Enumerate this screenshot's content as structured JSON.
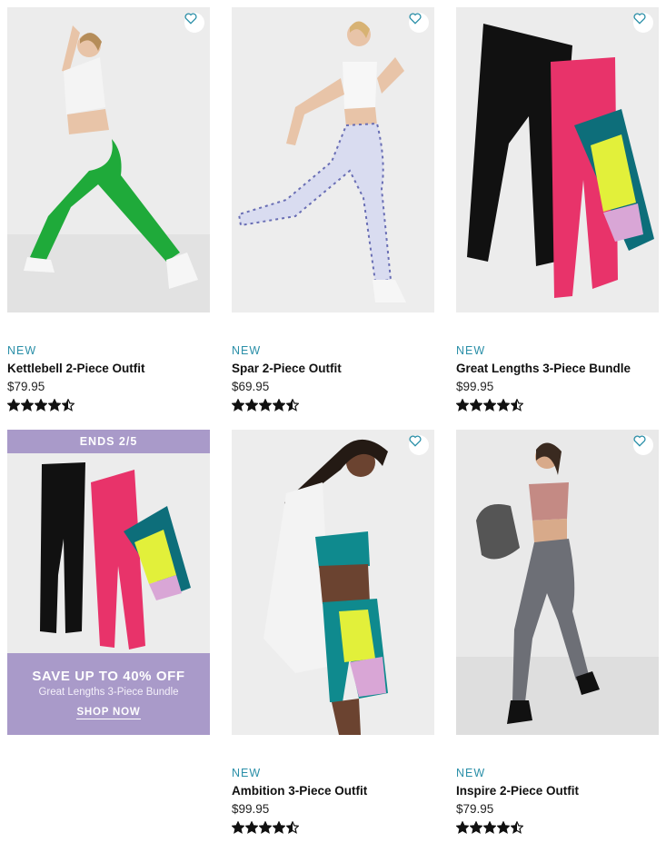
{
  "products": [
    {
      "badge": "NEW",
      "name": "Kettlebell 2-Piece Outfit",
      "price": "$79.95",
      "rating": 4.5,
      "icon": "heart-outline-icon"
    },
    {
      "badge": "NEW",
      "name": "Spar 2-Piece Outfit",
      "price": "$69.95",
      "rating": 4.5,
      "icon": "heart-outline-icon"
    },
    {
      "badge": "NEW",
      "name": "Great Lengths 3-Piece Bundle",
      "price": "$99.95",
      "rating": 4.5,
      "icon": "heart-outline-icon"
    },
    {
      "badge": "NEW",
      "name": "Ambition 3-Piece Outfit",
      "price": "$99.95",
      "rating": 4.5,
      "icon": "heart-outline-icon"
    },
    {
      "badge": "NEW",
      "name": "Inspire 2-Piece Outfit",
      "price": "$79.95",
      "rating": 4.5,
      "icon": "heart-outline-icon"
    }
  ],
  "promo": {
    "banner_top": "ENDS 2/5",
    "headline": "SAVE UP TO 40% OFF",
    "subtext": "Great Lengths 3-Piece Bundle",
    "cta": "SHOP NOW"
  },
  "colors": {
    "badge": "#2a8fa8",
    "promo_bg": "#a99ac9",
    "heart": "#2a8fa8",
    "star": "#111111"
  }
}
